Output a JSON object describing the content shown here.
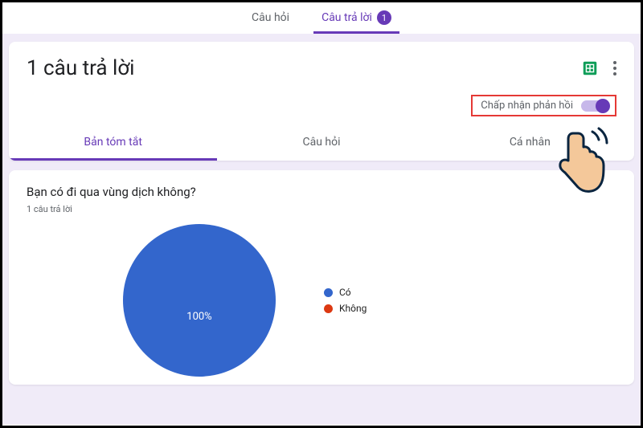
{
  "top_tabs": {
    "questions": "Câu hỏi",
    "responses": "Câu trả lời",
    "responses_count": "1"
  },
  "header": {
    "title": "1 câu trả lời",
    "accept_label": "Chấp nhận phản hồi"
  },
  "sub_tabs": {
    "summary": "Bản tóm tắt",
    "question": "Câu hỏi",
    "individual": "Cá nhân"
  },
  "question": {
    "title": "Bạn có đi qua vùng dịch không?",
    "count": "1 câu trả lời"
  },
  "chart_data": {
    "type": "pie",
    "categories": [
      "Có",
      "Không"
    ],
    "values": [
      1,
      0
    ],
    "percent_labels": [
      "100%",
      ""
    ],
    "colors": [
      "#3366cc",
      "#dc3912"
    ],
    "title": "Bạn có đi qua vùng dịch không?"
  },
  "legend": {
    "yes": "Có",
    "no": "Không"
  }
}
